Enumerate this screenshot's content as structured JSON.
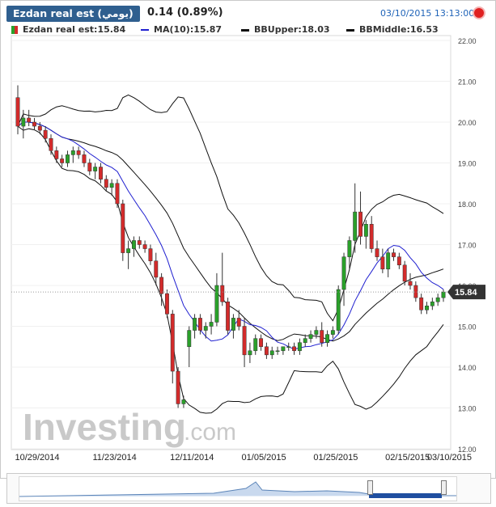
{
  "header": {
    "symbol_tab": "Ezdan real est (يومي)",
    "change": "0.14 (0.89%)",
    "datetime": "03/10/2015 13:13:00"
  },
  "legend": {
    "price": "Ezdan real est:15.84",
    "ma": "MA(10):15.87",
    "bb_upper": "BBUpper:18.03",
    "bb_middle": "BBMiddle:16.53"
  },
  "last_price_label": "15.84",
  "watermark": {
    "main": "Investing",
    "suffix": ".com"
  },
  "colors": {
    "up": "#2aa02a",
    "down": "#d32b2b",
    "ma": "#2020d0",
    "band": "#111111",
    "header": "#2f5f8f"
  },
  "chart_data": {
    "type": "candlestick",
    "y_ticks": [
      "22.00",
      "21.00",
      "20.00",
      "19.00",
      "18.00",
      "17.00",
      "16.00",
      "15.00",
      "14.00",
      "13.00",
      "12.00"
    ],
    "ylim": [
      12,
      22
    ],
    "x_tick_labels": [
      "10/29/2014",
      "11/23/2014",
      "12/11/2014",
      "01/05/2015",
      "01/25/2015",
      "02/15/2015",
      "03/10/2015"
    ],
    "x_tick_index": [
      0,
      14,
      28,
      41,
      54,
      67,
      80
    ],
    "last_price": 15.84,
    "candles": [
      [
        20.6,
        20.9,
        19.7,
        19.9
      ],
      [
        19.9,
        20.3,
        19.6,
        20.1
      ],
      [
        20.1,
        20.3,
        19.9,
        20.0
      ],
      [
        20.0,
        20.1,
        19.8,
        19.9
      ],
      [
        19.9,
        20.0,
        19.7,
        19.8
      ],
      [
        19.8,
        19.9,
        19.5,
        19.6
      ],
      [
        19.6,
        19.7,
        19.2,
        19.3
      ],
      [
        19.3,
        19.4,
        19.0,
        19.1
      ],
      [
        19.1,
        19.2,
        18.9,
        19.0
      ],
      [
        19.0,
        19.3,
        18.9,
        19.2
      ],
      [
        19.2,
        19.4,
        19.0,
        19.3
      ],
      [
        19.3,
        19.4,
        19.1,
        19.2
      ],
      [
        19.2,
        19.3,
        18.9,
        19.0
      ],
      [
        19.0,
        19.1,
        18.7,
        18.8
      ],
      [
        18.8,
        19.0,
        18.6,
        18.9
      ],
      [
        18.9,
        19.0,
        18.5,
        18.6
      ],
      [
        18.6,
        18.7,
        18.3,
        18.4
      ],
      [
        18.4,
        18.6,
        18.2,
        18.5
      ],
      [
        18.5,
        18.6,
        17.9,
        18.0
      ],
      [
        18.0,
        18.1,
        16.6,
        16.8
      ],
      [
        16.8,
        17.1,
        16.4,
        16.9
      ],
      [
        16.9,
        17.2,
        16.7,
        17.1
      ],
      [
        17.1,
        17.2,
        16.9,
        17.0
      ],
      [
        17.0,
        17.1,
        16.8,
        16.9
      ],
      [
        16.9,
        17.0,
        16.5,
        16.6
      ],
      [
        16.6,
        16.8,
        16.0,
        16.2
      ],
      [
        16.2,
        16.3,
        15.5,
        15.8
      ],
      [
        15.8,
        15.9,
        15.2,
        15.3
      ],
      [
        15.3,
        15.4,
        13.6,
        13.9
      ],
      [
        13.9,
        14.0,
        13.0,
        13.1
      ],
      [
        13.1,
        13.3,
        13.0,
        13.2
      ],
      [
        14.5,
        15.0,
        14.0,
        14.9
      ],
      [
        14.9,
        15.3,
        14.7,
        15.2
      ],
      [
        15.2,
        15.3,
        14.8,
        14.9
      ],
      [
        14.9,
        15.1,
        14.7,
        15.0
      ],
      [
        15.0,
        15.3,
        14.8,
        15.1
      ],
      [
        15.1,
        16.3,
        15.0,
        16.0
      ],
      [
        16.0,
        16.8,
        15.5,
        15.6
      ],
      [
        15.6,
        15.7,
        14.8,
        14.9
      ],
      [
        14.9,
        15.3,
        14.7,
        15.2
      ],
      [
        15.2,
        15.4,
        14.9,
        15.0
      ],
      [
        15.0,
        15.2,
        14.0,
        14.3
      ],
      [
        14.3,
        14.6,
        14.1,
        14.4
      ],
      [
        14.4,
        14.8,
        14.3,
        14.7
      ],
      [
        14.7,
        14.8,
        14.4,
        14.5
      ],
      [
        14.5,
        14.6,
        14.2,
        14.3
      ],
      [
        14.3,
        14.5,
        14.2,
        14.4
      ],
      [
        14.4,
        14.5,
        14.3,
        14.4
      ],
      [
        14.4,
        14.5,
        14.3,
        14.5
      ],
      [
        14.5,
        14.6,
        14.4,
        14.5
      ],
      [
        14.5,
        14.6,
        14.3,
        14.4
      ],
      [
        14.4,
        14.7,
        14.3,
        14.6
      ],
      [
        14.6,
        14.8,
        14.5,
        14.7
      ],
      [
        14.7,
        14.9,
        14.6,
        14.8
      ],
      [
        14.8,
        15.0,
        14.7,
        14.9
      ],
      [
        14.9,
        15.1,
        14.5,
        14.6
      ],
      [
        14.6,
        14.9,
        14.5,
        14.8
      ],
      [
        14.8,
        15.0,
        14.7,
        14.9
      ],
      [
        14.9,
        16.0,
        14.8,
        15.9
      ],
      [
        15.9,
        16.8,
        15.5,
        16.7
      ],
      [
        16.7,
        17.2,
        16.4,
        17.1
      ],
      [
        17.1,
        18.5,
        16.8,
        17.8
      ],
      [
        17.8,
        18.3,
        17.0,
        17.2
      ],
      [
        17.2,
        17.6,
        16.9,
        17.5
      ],
      [
        17.5,
        17.7,
        16.8,
        16.9
      ],
      [
        16.9,
        17.1,
        16.6,
        16.7
      ],
      [
        16.7,
        16.9,
        16.3,
        16.4
      ],
      [
        16.4,
        16.9,
        16.2,
        16.8
      ],
      [
        16.8,
        16.9,
        16.6,
        16.7
      ],
      [
        16.7,
        16.8,
        16.4,
        16.5
      ],
      [
        16.5,
        16.6,
        16.0,
        16.1
      ],
      [
        16.1,
        16.3,
        15.9,
        16.0
      ],
      [
        16.0,
        16.1,
        15.6,
        15.7
      ],
      [
        15.7,
        15.8,
        15.3,
        15.4
      ],
      [
        15.4,
        15.6,
        15.3,
        15.5
      ],
      [
        15.5,
        15.7,
        15.4,
        15.6
      ],
      [
        15.6,
        15.8,
        15.5,
        15.7
      ],
      [
        15.7,
        15.9,
        15.6,
        15.84
      ]
    ]
  }
}
